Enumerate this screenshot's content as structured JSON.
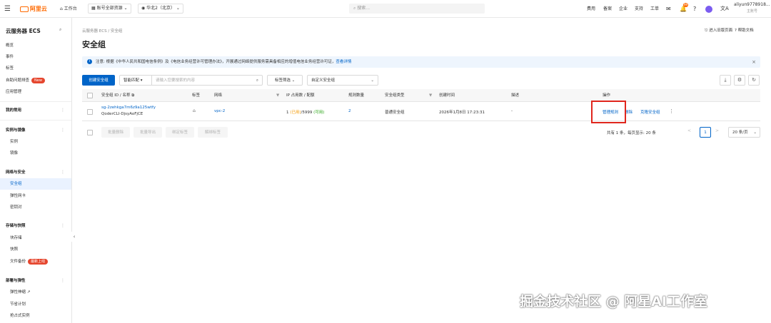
{
  "topbar": {
    "logo_text": "阿里云",
    "workbench": "工作台",
    "account_resources": "账号全部资源",
    "region": "华北2（北京）",
    "search_placeholder": "搜索...",
    "links": [
      "费用",
      "备案",
      "企业",
      "支持",
      "工单"
    ],
    "notification_count": "99",
    "username": "aliyun9778918...",
    "account_type": "主账号"
  },
  "sidebar": {
    "title": "云服务器 ECS",
    "items": [
      {
        "label": "概览"
      },
      {
        "label": "事件"
      },
      {
        "label": "标签"
      },
      {
        "label": "自助问题排查",
        "badge": "New"
      },
      {
        "label": "应用管理"
      }
    ],
    "favorites": "我的常用",
    "groups": [
      {
        "label": "实例与镜像",
        "items": [
          "实例",
          "镜像"
        ]
      },
      {
        "label": "网络与安全",
        "items": [
          "安全组",
          "弹性网卡",
          "密钥对"
        ]
      },
      {
        "label": "存储与快照",
        "items": [
          "块存储",
          "快照",
          "文件备份"
        ],
        "badge": "最新上线"
      },
      {
        "label": "部署与弹性",
        "items": [
          "弹性伸缩",
          "节省计划",
          "抢占式实例"
        ]
      }
    ]
  },
  "breadcrumb": {
    "root": "云服务器 ECS",
    "sep": "/",
    "current": "安全组"
  },
  "header_links": {
    "legacy": "进入旧版页面",
    "help": "帮助文档"
  },
  "page_title": "安全组",
  "notice": {
    "label": "注意:",
    "text": "根据《中华人民共和国电信条例》及《电信业务经营许可管理办法》，开展通过网络提供服务需具备相应的增值电信业务经营许可证，",
    "link": "查看详情"
  },
  "toolbar": {
    "create": "创建安全组",
    "smart_match": "智能匹配",
    "search_placeholder": "请输入您要搜索的内容",
    "tag_filter": "标签筛选",
    "custom_sg": "自定义安全组"
  },
  "table": {
    "headers": [
      "安全组 ID / 名称",
      "标签",
      "网络",
      "IP 占用数 / 配额",
      "规则数量",
      "安全组类型",
      "创建时间",
      "描述",
      "操作"
    ],
    "row": {
      "id": "sg-2zehkga7m6z9a125wtfy",
      "name": "QoderCLI-DjsyAoFjCE",
      "vpc": "vpc-2",
      "ip_used": "1",
      "ip_used_status": "(已用)",
      "ip_quota": "/5999",
      "ip_available": "(可用)",
      "rule_count": "2",
      "type": "普通安全组",
      "created": "2026年1月8日 17:23:31",
      "description": "-",
      "actions": [
        "管理规则",
        "删除",
        "克隆安全组"
      ],
      "more": "⋮"
    }
  },
  "bulk_actions": [
    "批量删除",
    "批量导出",
    "绑定标签",
    "解绑标签"
  ],
  "pagination": {
    "summary": "共有 1 条，每页显示: 20 条",
    "prev": "<",
    "current_page": "1",
    "next": ">",
    "page_size": "20 条/页"
  },
  "watermark": "掘金技术社区 @ 阿星AI工作室",
  "colors": {
    "primary": "#0064c8",
    "badge_red": "#e5462e",
    "highlight_box": "#e0261d",
    "notice_bg": "#eef5fd",
    "status_orange": "#f39800",
    "status_green": "#2aa515"
  }
}
